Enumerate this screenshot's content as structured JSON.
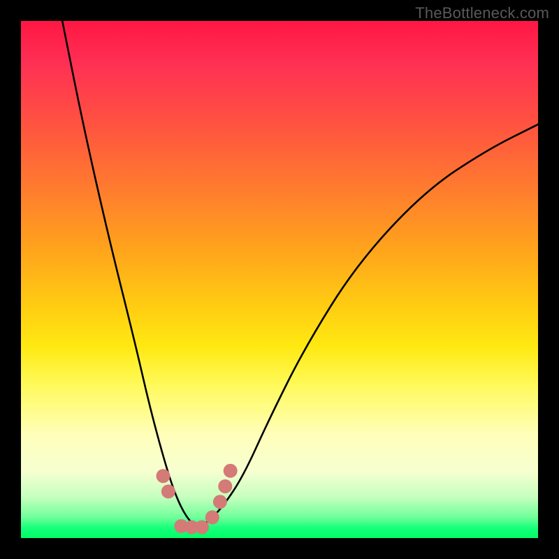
{
  "watermark": "TheBottleneck.com",
  "chart_data": {
    "type": "line",
    "title": "",
    "xlabel": "",
    "ylabel": "",
    "xlim": [
      0,
      100
    ],
    "ylim": [
      0,
      100
    ],
    "series": [
      {
        "name": "bottleneck-curve",
        "x": [
          8,
          12,
          17,
          22,
          25,
          28,
          30,
          32,
          34,
          36,
          39,
          43,
          48,
          55,
          65,
          78,
          90,
          100
        ],
        "y": [
          100,
          80,
          58,
          38,
          25,
          14,
          8,
          4,
          2,
          3,
          6,
          12,
          23,
          37,
          53,
          67,
          75,
          80
        ]
      }
    ],
    "markers": {
      "name": "highlight-dots",
      "color": "#d47a77",
      "x": [
        27.5,
        28.5,
        31,
        33,
        35,
        37,
        38.5,
        39.5,
        40.5
      ],
      "y": [
        12,
        9,
        2.3,
        2.1,
        2.1,
        4,
        7,
        10,
        13
      ]
    },
    "gradient_stops": [
      {
        "pos": 0,
        "color": "#ff1744"
      },
      {
        "pos": 20,
        "color": "#ff5340"
      },
      {
        "pos": 44,
        "color": "#ffa31c"
      },
      {
        "pos": 63,
        "color": "#ffe912"
      },
      {
        "pos": 80,
        "color": "#ffffba"
      },
      {
        "pos": 92,
        "color": "#c7ffbf"
      },
      {
        "pos": 100,
        "color": "#00ff68"
      }
    ]
  }
}
